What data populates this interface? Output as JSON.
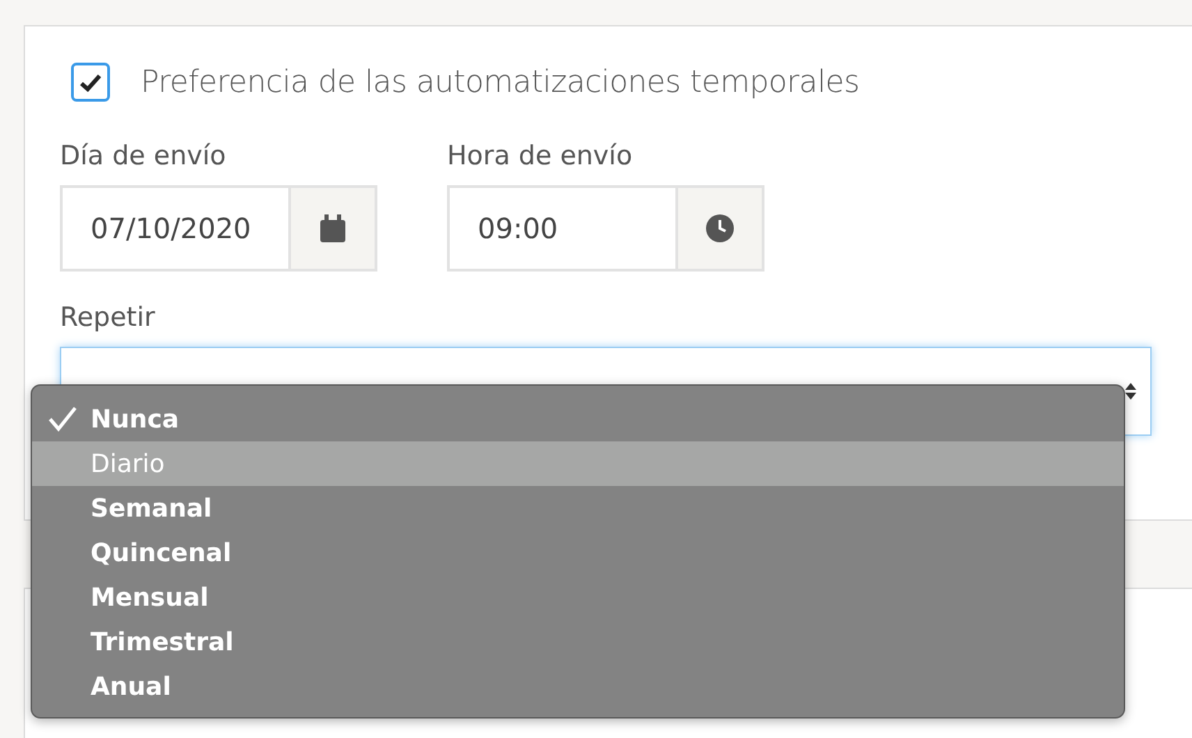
{
  "automation": {
    "checked": true,
    "label": "Preferencia de las automatizaciones temporales"
  },
  "send_day": {
    "label": "Día de envío",
    "value": "07/10/2020"
  },
  "send_time": {
    "label": "Hora de envío",
    "value": "09:00"
  },
  "repeat": {
    "label": "Repetir",
    "open": true,
    "options": [
      {
        "label": "Nunca",
        "selected": true,
        "highlighted": false
      },
      {
        "label": "Diario",
        "selected": false,
        "highlighted": true
      },
      {
        "label": "Semanal",
        "selected": false,
        "highlighted": false
      },
      {
        "label": "Quincenal",
        "selected": false,
        "highlighted": false
      },
      {
        "label": "Mensual",
        "selected": false,
        "highlighted": false
      },
      {
        "label": "Trimestral",
        "selected": false,
        "highlighted": false
      },
      {
        "label": "Anual",
        "selected": false,
        "highlighted": false
      }
    ]
  }
}
